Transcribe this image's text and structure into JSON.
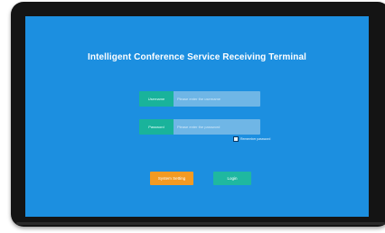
{
  "screen": {
    "title": "Intelligent Conference Service Receiving Terminal"
  },
  "login_form": {
    "username_label": "Username",
    "username_placeholder": "Please enter the username",
    "password_label": "Password",
    "password_placeholder": "Please enter the password",
    "remember_label": "Remember password",
    "remember_checked": false
  },
  "buttons": {
    "setting_label": "System Setting",
    "login_label": "Login"
  },
  "colors": {
    "screen_background": "#1c8fe0",
    "label_teal": "#19b39b",
    "input_blue": "#6fb6e6",
    "setting_orange": "#f39a22",
    "login_teal": "#1fb8a0",
    "bezel": "#141414"
  }
}
